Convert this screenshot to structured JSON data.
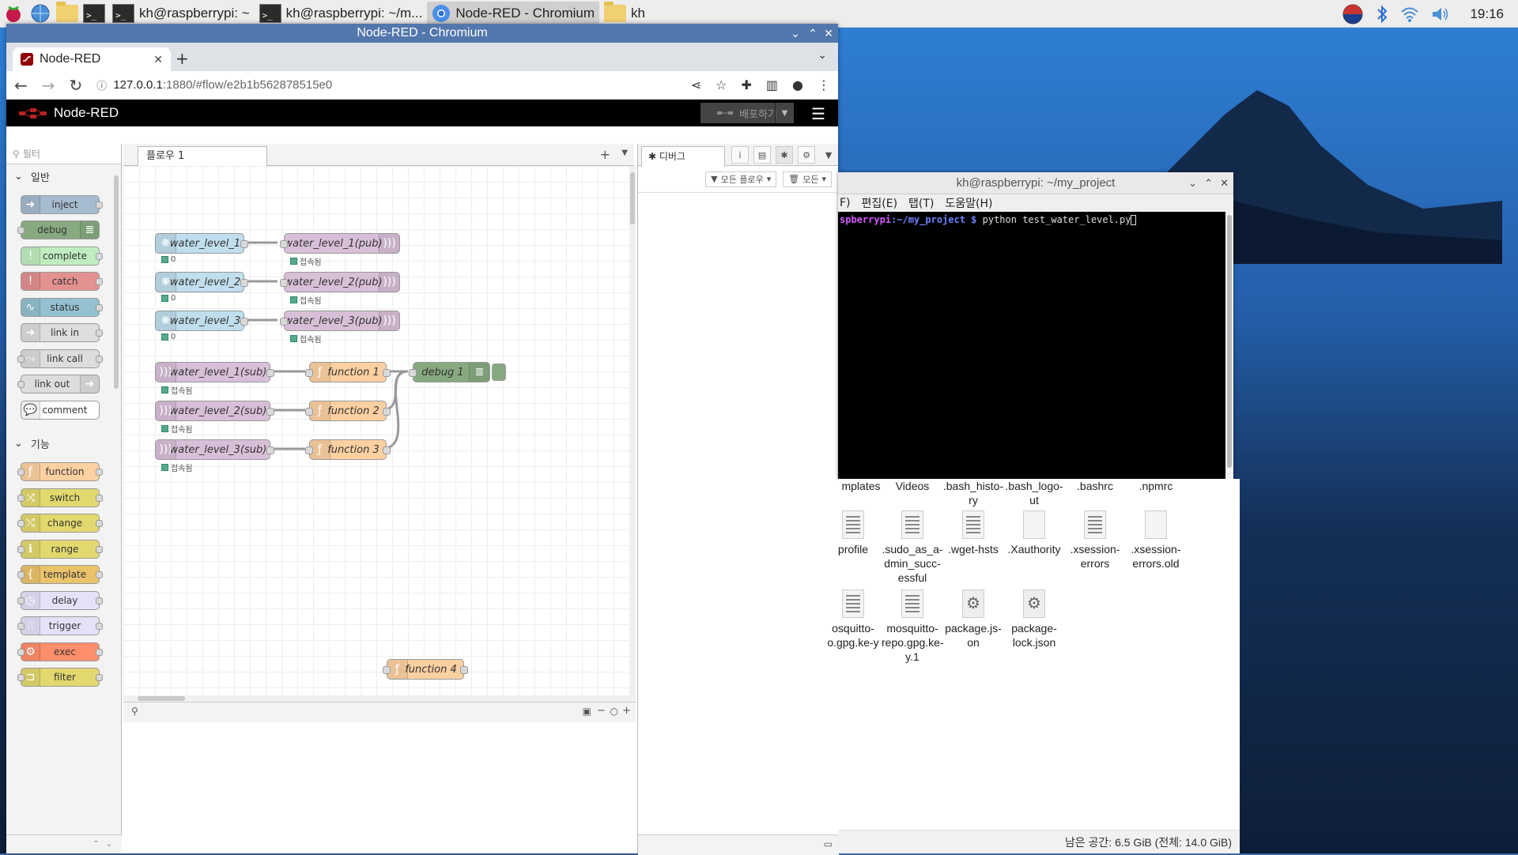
{
  "taskbar": {
    "tasks": [
      {
        "label": "kh@raspberrypi: ~",
        "icon": "terminal-icon"
      },
      {
        "label": "kh@raspberrypi: ~/m...",
        "icon": "terminal-icon"
      },
      {
        "label": "Node-RED - Chromium",
        "icon": "chromium-icon"
      },
      {
        "label": "kh",
        "icon": "folder-icon"
      }
    ],
    "clock": "19:16"
  },
  "browser": {
    "window_title": "Node-RED - Chromium",
    "tab_label": "Node-RED",
    "url_host": "127.0.0.1",
    "url_path": ":1880/#flow/e2b1b562878515e0"
  },
  "nodered": {
    "app_name": "Node-RED",
    "deploy_label": "배포하기",
    "palette": {
      "filter_placeholder": "필터",
      "cat_common": "일반",
      "cat_function": "기능",
      "common_nodes": [
        "inject",
        "debug",
        "complete",
        "catch",
        "status",
        "link in",
        "link call",
        "link out",
        "comment"
      ],
      "function_nodes": [
        "function",
        "switch",
        "change",
        "range",
        "template",
        "delay",
        "trigger",
        "exec",
        "filter"
      ]
    },
    "workspace": {
      "flow_tab": "플로우 1",
      "nodes": {
        "wl1": "water_level_1",
        "wl2": "water_level_2",
        "wl3": "water_level_3",
        "pub1": "water_level_1(pub)",
        "pub2": "water_level_2(pub)",
        "pub3": "water_level_3(pub)",
        "sub1": "water_level_1(sub)",
        "sub2": "water_level_2(sub)",
        "sub3": "water_level_3(sub)",
        "f1": "function 1",
        "f2": "function 2",
        "f3": "function 3",
        "f4": "function 4",
        "debug1": "debug 1"
      },
      "status_zero": "0",
      "status_connected": "접속됨"
    },
    "sidebar": {
      "debug_tab": "디버그",
      "filter_flows": "모든 플로우",
      "clear_label": "모든"
    }
  },
  "terminal": {
    "title": "kh@raspberrypi: ~/my_project",
    "menu": [
      "F)",
      "편집(E)",
      "탭(T)",
      "도움말(H)"
    ],
    "prompt_user": "spberrypi",
    "prompt_path": ":~/my_project $",
    "command": " python test_water_level.py"
  },
  "file_manager": {
    "items_row1": [
      ".bash_histo-ry",
      ".bash_logo-ut",
      ".bashrc",
      ".npmrc"
    ],
    "row1_partial": [
      "mplates",
      "Videos"
    ],
    "items_row2": [
      "profile",
      ".sudo_as_a-dmin_succ-essful",
      ".wget-hsts",
      ".Xauthority",
      ".xsession-errors",
      ".xsession-errors.old"
    ],
    "items_row3": [
      "osquitto-o.gpg.ke-y",
      "mosquitto-repo.gpg.ke-y.1",
      "package.js-on",
      "package-lock.json"
    ],
    "status": "남은 공간: 6.5 GiB (전체: 14.0 GiB)"
  },
  "colors": {
    "inject": "#a6bbcf",
    "debug": "#87a980",
    "complete": "#c0edc0",
    "catch": "#e49191",
    "status": "#94c1d0",
    "link": "#dddddd",
    "function": "#fdd0a2",
    "switch": "#e2d96e",
    "template": "#ebc36b",
    "delay": "#e6e0f8",
    "trigger": "#e6e0f8",
    "exec": "#ff8f6b",
    "filter": "#e2d96e",
    "mqtt": "#d8bfd8",
    "rpi": "#c0deed"
  }
}
